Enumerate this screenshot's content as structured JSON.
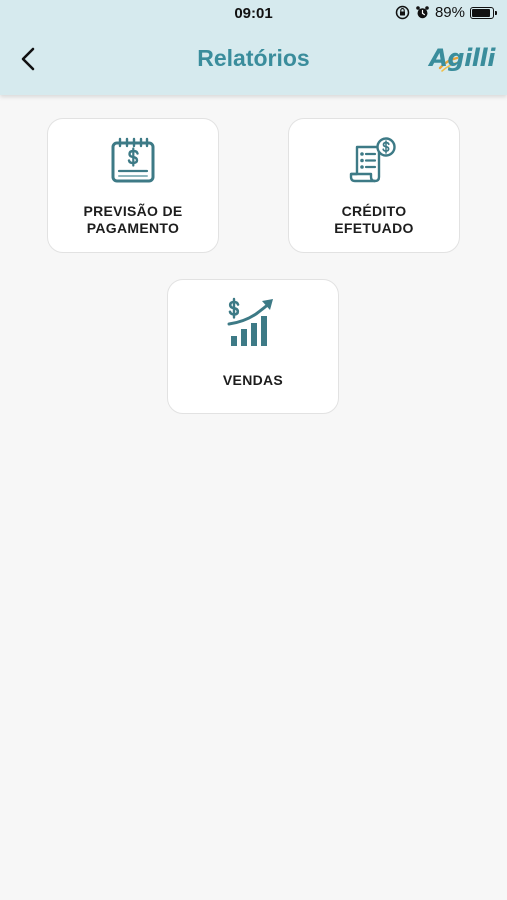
{
  "status_bar": {
    "time": "09:01",
    "battery_percent": "89%",
    "battery_level": 0.89,
    "icons": [
      "orientation-lock-icon",
      "alarm-icon",
      "battery-icon"
    ]
  },
  "header": {
    "title": "Relatórios",
    "back_icon": "chevron-left-icon",
    "logo_text": "Agilli"
  },
  "colors": {
    "header_bg": "#d6eaee",
    "accent": "#3a8d9c",
    "icon_teal": "#3d7a86",
    "page_bg": "#f7f7f7"
  },
  "reports": [
    {
      "id": "previsao",
      "icon": "calendar-dollar-icon",
      "label_line1": "PREVISÃO DE",
      "label_line2": "PAGAMENTO"
    },
    {
      "id": "credito",
      "icon": "receipt-dollar-icon",
      "label_line1": "CRÉDITO",
      "label_line2": "EFETUADO"
    },
    {
      "id": "vendas",
      "icon": "sales-growth-chart-icon",
      "label_line1": "VENDAS",
      "label_line2": ""
    }
  ]
}
